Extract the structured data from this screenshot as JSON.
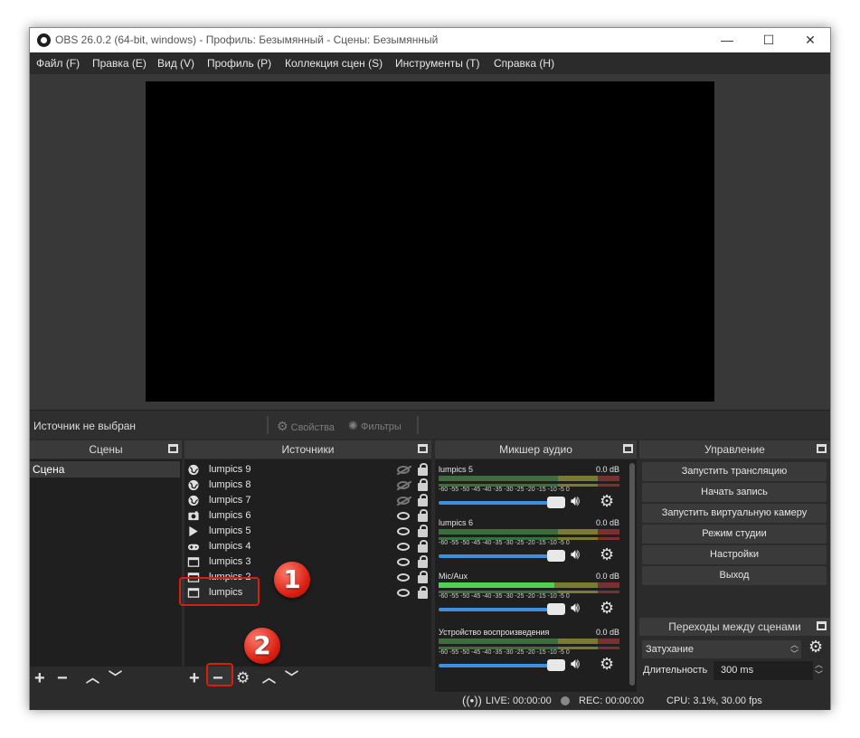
{
  "window": {
    "title": "OBS 26.0.2 (64-bit, windows) - Профиль: Безымянный - Сцены: Безымянный",
    "minimize": "—",
    "maximize": "☐",
    "close": "✕"
  },
  "menu": [
    "Файл (F)",
    "Правка (E)",
    "Вид (V)",
    "Профиль (P)",
    "Коллекция сцен (S)",
    "Инструменты (T)",
    "Справка (H)"
  ],
  "source_toolbar": {
    "no_source": "Источник не выбран",
    "properties": "Свойства",
    "filters": "Фильтры"
  },
  "scenes": {
    "title": "Сцены",
    "items": [
      "Сцена"
    ]
  },
  "sources": {
    "title": "Источники",
    "items": [
      {
        "label": "lumpics 9",
        "icon": "globe-icon",
        "visible": false
      },
      {
        "label": "lumpics 8",
        "icon": "globe-icon",
        "visible": false
      },
      {
        "label": "lumpics 7",
        "icon": "globe-icon",
        "visible": false
      },
      {
        "label": "lumpics 6",
        "icon": "camera-icon",
        "visible": true
      },
      {
        "label": "lumpics 5",
        "icon": "play-icon",
        "visible": true
      },
      {
        "label": "lumpics 4",
        "icon": "gamepad-icon",
        "visible": true
      },
      {
        "label": "lumpics 3",
        "icon": "window-icon",
        "visible": true
      },
      {
        "label": "lumpics 2",
        "icon": "window-icon",
        "visible": true
      },
      {
        "label": "lumpics",
        "icon": "window-icon",
        "visible": true
      }
    ]
  },
  "mixer": {
    "title": "Микшер аудио",
    "ticks": "-60  -55  -50  -45  -40  -35  -30  -25  -20  -15  -10   -5    0",
    "channels": [
      {
        "name": "lumpics 5",
        "db": "0.0 dB"
      },
      {
        "name": "lumpics 6",
        "db": "0.0 dB"
      },
      {
        "name": "Mic/Aux",
        "db": "0.0 dB"
      },
      {
        "name": "Устройство воспроизведения",
        "db": "0.0 dB"
      }
    ]
  },
  "controls": {
    "title": "Управление",
    "buttons": [
      "Запустить трансляцию",
      "Начать запись",
      "Запустить виртуальную камеру",
      "Режим студии",
      "Настройки",
      "Выход"
    ]
  },
  "transitions": {
    "title": "Переходы между сценами",
    "selected": "Затухание",
    "duration_label": "Длительность",
    "duration_value": "300 ms"
  },
  "status": {
    "live": "LIVE: 00:00:00",
    "rec": "REC: 00:00:00",
    "cpu": "CPU: 3.1%, 30.00 fps"
  },
  "annotations": {
    "step1": "1",
    "step2": "2",
    "accent": "#d81e10"
  }
}
